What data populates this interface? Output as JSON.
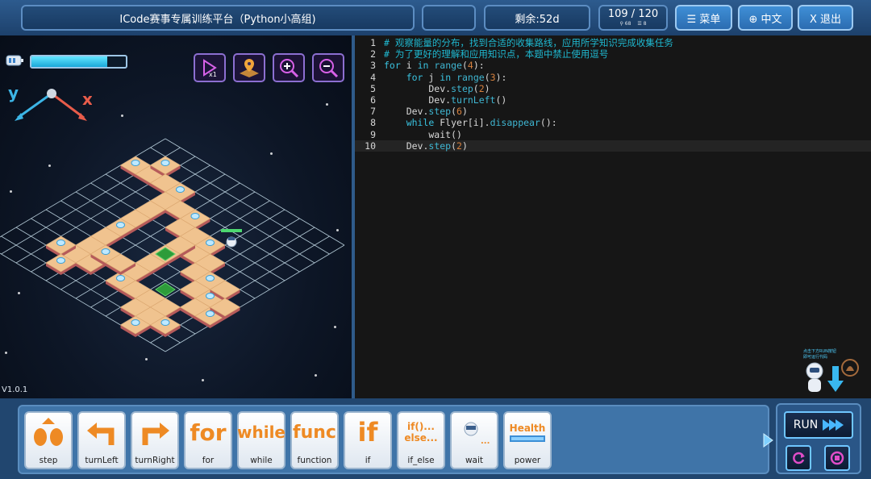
{
  "topbar": {
    "title": "ICode赛事专属训练平台（Python小高组)",
    "remaining": "剩余:52d",
    "progress": "109 / 120",
    "stat_a": "68",
    "stat_b": "8",
    "menu_label": "☰ 菜单",
    "lang_label": "⊕ 中文",
    "exit_label": "X 退出"
  },
  "game": {
    "version": "V1.0.1",
    "energy_percent": 80,
    "axis_y": "y",
    "axis_x": "x",
    "accent_color": "#f0a43a"
  },
  "editor": {
    "lines": [
      {
        "n": "1",
        "parts": [
          [
            "comment",
            "# 观察能量的分布，找到合适的收集路线，应用所学知识完成收集任务"
          ]
        ]
      },
      {
        "n": "2",
        "parts": [
          [
            "comment",
            "# 为了更好的理解和应用知识点，本题中禁止使用逗号"
          ]
        ]
      },
      {
        "n": "3",
        "parts": [
          [
            "kw",
            "for"
          ],
          [
            "plain",
            " i "
          ],
          [
            "kw",
            "in"
          ],
          [
            "plain",
            " "
          ],
          [
            "fn",
            "range"
          ],
          [
            "plain",
            "("
          ],
          [
            "num",
            "4"
          ],
          [
            "plain",
            "):"
          ]
        ]
      },
      {
        "n": "4",
        "parts": [
          [
            "plain",
            "    "
          ],
          [
            "kw",
            "for"
          ],
          [
            "plain",
            " j "
          ],
          [
            "kw",
            "in"
          ],
          [
            "plain",
            " "
          ],
          [
            "fn",
            "range"
          ],
          [
            "plain",
            "("
          ],
          [
            "num",
            "3"
          ],
          [
            "plain",
            "):"
          ]
        ]
      },
      {
        "n": "5",
        "parts": [
          [
            "plain",
            "        Dev."
          ],
          [
            "fn",
            "step"
          ],
          [
            "plain",
            "("
          ],
          [
            "num",
            "2"
          ],
          [
            "plain",
            ")"
          ]
        ]
      },
      {
        "n": "6",
        "parts": [
          [
            "plain",
            "        Dev."
          ],
          [
            "fn",
            "turnLeft"
          ],
          [
            "plain",
            "()"
          ]
        ]
      },
      {
        "n": "7",
        "parts": [
          [
            "plain",
            "    Dev."
          ],
          [
            "fn",
            "step"
          ],
          [
            "plain",
            "("
          ],
          [
            "num",
            "6"
          ],
          [
            "plain",
            ")"
          ]
        ]
      },
      {
        "n": "8",
        "parts": [
          [
            "plain",
            "    "
          ],
          [
            "kw",
            "while"
          ],
          [
            "plain",
            " Flyer[i]."
          ],
          [
            "fn",
            "disappear"
          ],
          [
            "plain",
            "():"
          ]
        ]
      },
      {
        "n": "9",
        "parts": [
          [
            "plain",
            "        wait()"
          ]
        ]
      },
      {
        "n": "10",
        "parts": [
          [
            "plain",
            "    Dev."
          ],
          [
            "fn",
            "step"
          ],
          [
            "plain",
            "("
          ],
          [
            "num",
            "2"
          ],
          [
            "plain",
            ")"
          ]
        ]
      }
    ],
    "helper_text_1": "点击下方RUN按钮",
    "helper_text_2": "即可运行代码"
  },
  "blocks": [
    {
      "name": "step",
      "label": "step",
      "art": "step"
    },
    {
      "name": "turnleft",
      "label": "turnLeft",
      "art": "left"
    },
    {
      "name": "turnright",
      "label": "turnRight",
      "art": "right"
    },
    {
      "name": "for",
      "label": "for",
      "art": "for"
    },
    {
      "name": "while",
      "label": "while",
      "art": "while"
    },
    {
      "name": "function",
      "label": "function",
      "art": "func"
    },
    {
      "name": "if",
      "label": "if",
      "art": "if"
    },
    {
      "name": "if-else",
      "label": "if_else",
      "art": "if()...\nelse..."
    },
    {
      "name": "wait",
      "label": "wait",
      "art": "wait"
    },
    {
      "name": "power",
      "label": "power",
      "art": "Health"
    }
  ],
  "run": {
    "run_label": "RUN"
  }
}
